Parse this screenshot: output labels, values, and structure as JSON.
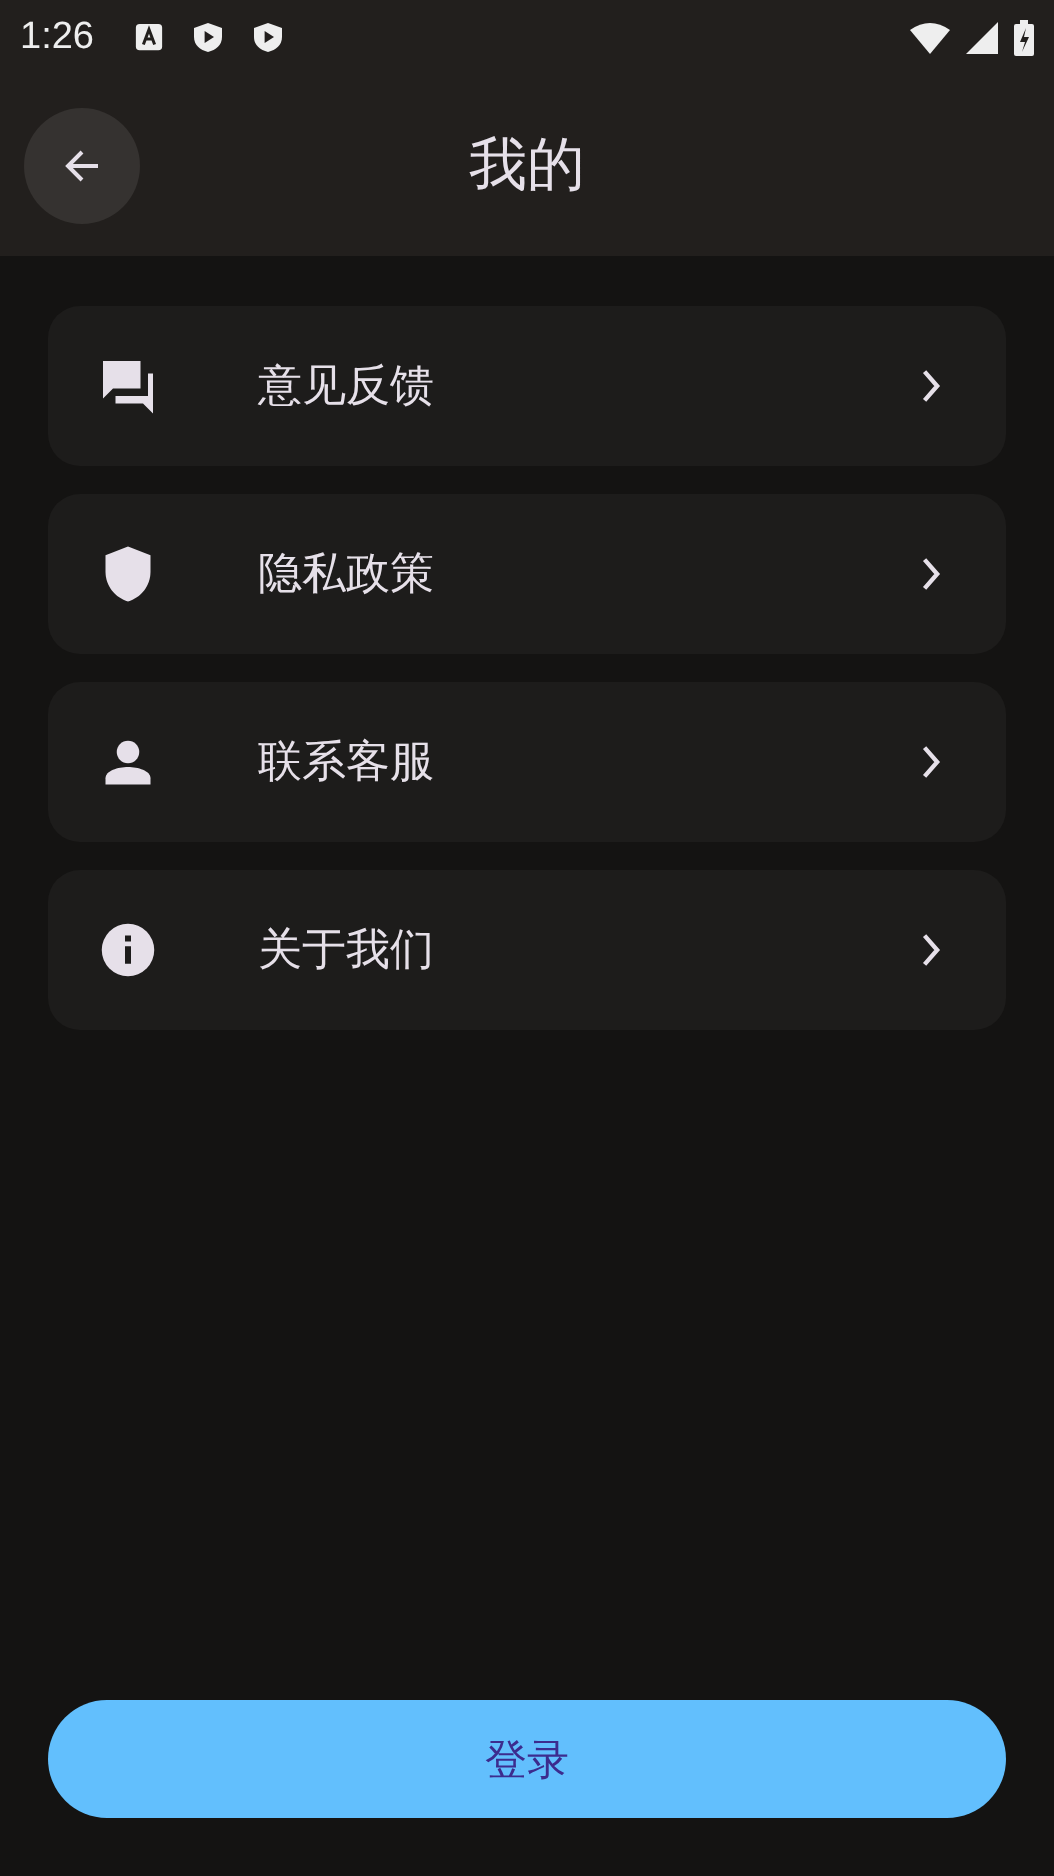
{
  "status_bar": {
    "time": "1:26"
  },
  "app_bar": {
    "title": "我的"
  },
  "menu": [
    {
      "kind": "feedback",
      "label": "意见反馈"
    },
    {
      "kind": "privacy",
      "label": "隐私政策"
    },
    {
      "kind": "contact",
      "label": "联系客服"
    },
    {
      "kind": "about",
      "label": "关于我们"
    }
  ],
  "login_button": {
    "label": "登录"
  }
}
